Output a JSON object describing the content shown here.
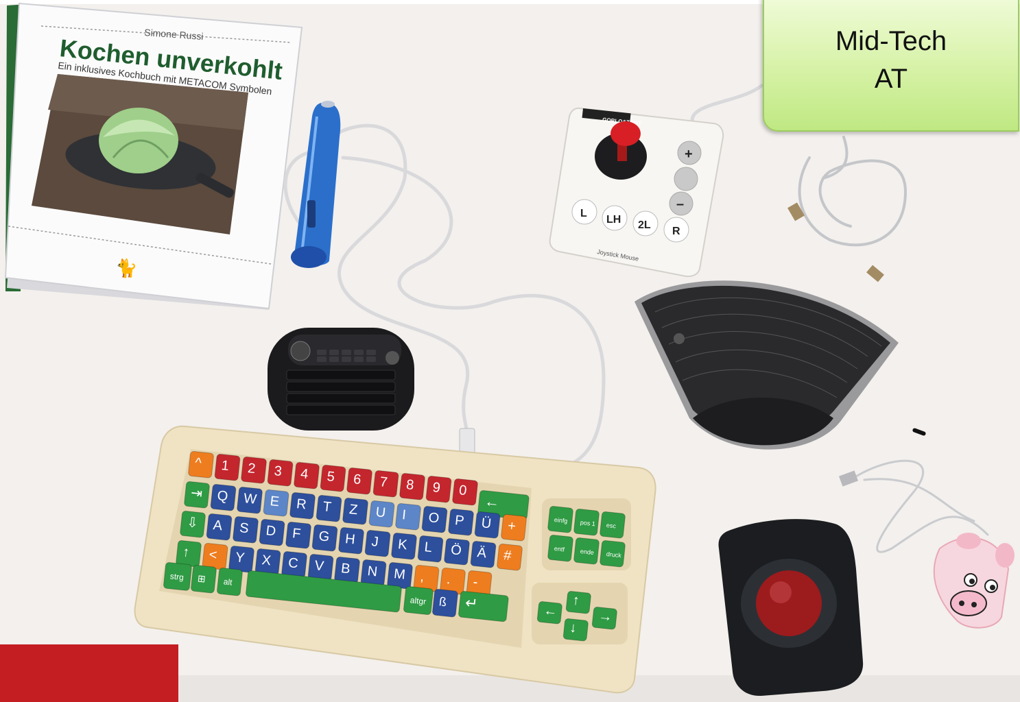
{
  "label": {
    "line1": "Mid-Tech",
    "line2": "AT"
  },
  "book": {
    "author": "Simone Russi",
    "title": "Kochen unverkohlt",
    "subtitle": "Ein inklusives Kochbuch mit METACOM Symbolen"
  },
  "joystick": {
    "brand": "GORLO&TODT",
    "device_text": "Joystick Mouse",
    "buttons": [
      "L",
      "LH",
      "2L",
      "R"
    ],
    "side_buttons": [
      "+",
      "",
      "–"
    ]
  },
  "big_keyboard": {
    "row1": [
      "^",
      "1",
      "2",
      "3",
      "4",
      "5",
      "6",
      "7",
      "8",
      "9",
      "0",
      "←"
    ],
    "row1_sup": [
      "°",
      "!",
      "\"",
      "§",
      "$",
      "%",
      "&",
      "/",
      "(",
      ")",
      "="
    ],
    "row2": [
      "⇥",
      "Q",
      "W",
      "E",
      "R",
      "T",
      "Z",
      "U",
      "I",
      "O",
      "P",
      "Ü",
      "+"
    ],
    "row3": [
      "⇩",
      "A",
      "S",
      "D",
      "F",
      "G",
      "H",
      "J",
      "K",
      "L",
      "Ö",
      "Ä",
      "#"
    ],
    "row4": [
      "↑",
      "<",
      "Y",
      "X",
      "C",
      "V",
      "B",
      "N",
      "M",
      ",",
      ".",
      "-"
    ],
    "row5": [
      "strg",
      "⊞",
      "alt",
      "altgr",
      "ß",
      "↵"
    ],
    "nav_keys": [
      "einfg",
      "pos 1",
      "esc",
      "entf",
      "ende",
      "druck"
    ],
    "arrows": [
      "↑",
      "←",
      "→",
      "↓"
    ]
  },
  "colors": {
    "background": "#f2efec",
    "label_green": "#d6f2a6",
    "key_red": "#c4262e",
    "key_blue": "#2d4f9c",
    "key_green": "#2f9b44",
    "key_orange": "#ee7d1f",
    "keyboard_frame": "#efe3c6"
  }
}
